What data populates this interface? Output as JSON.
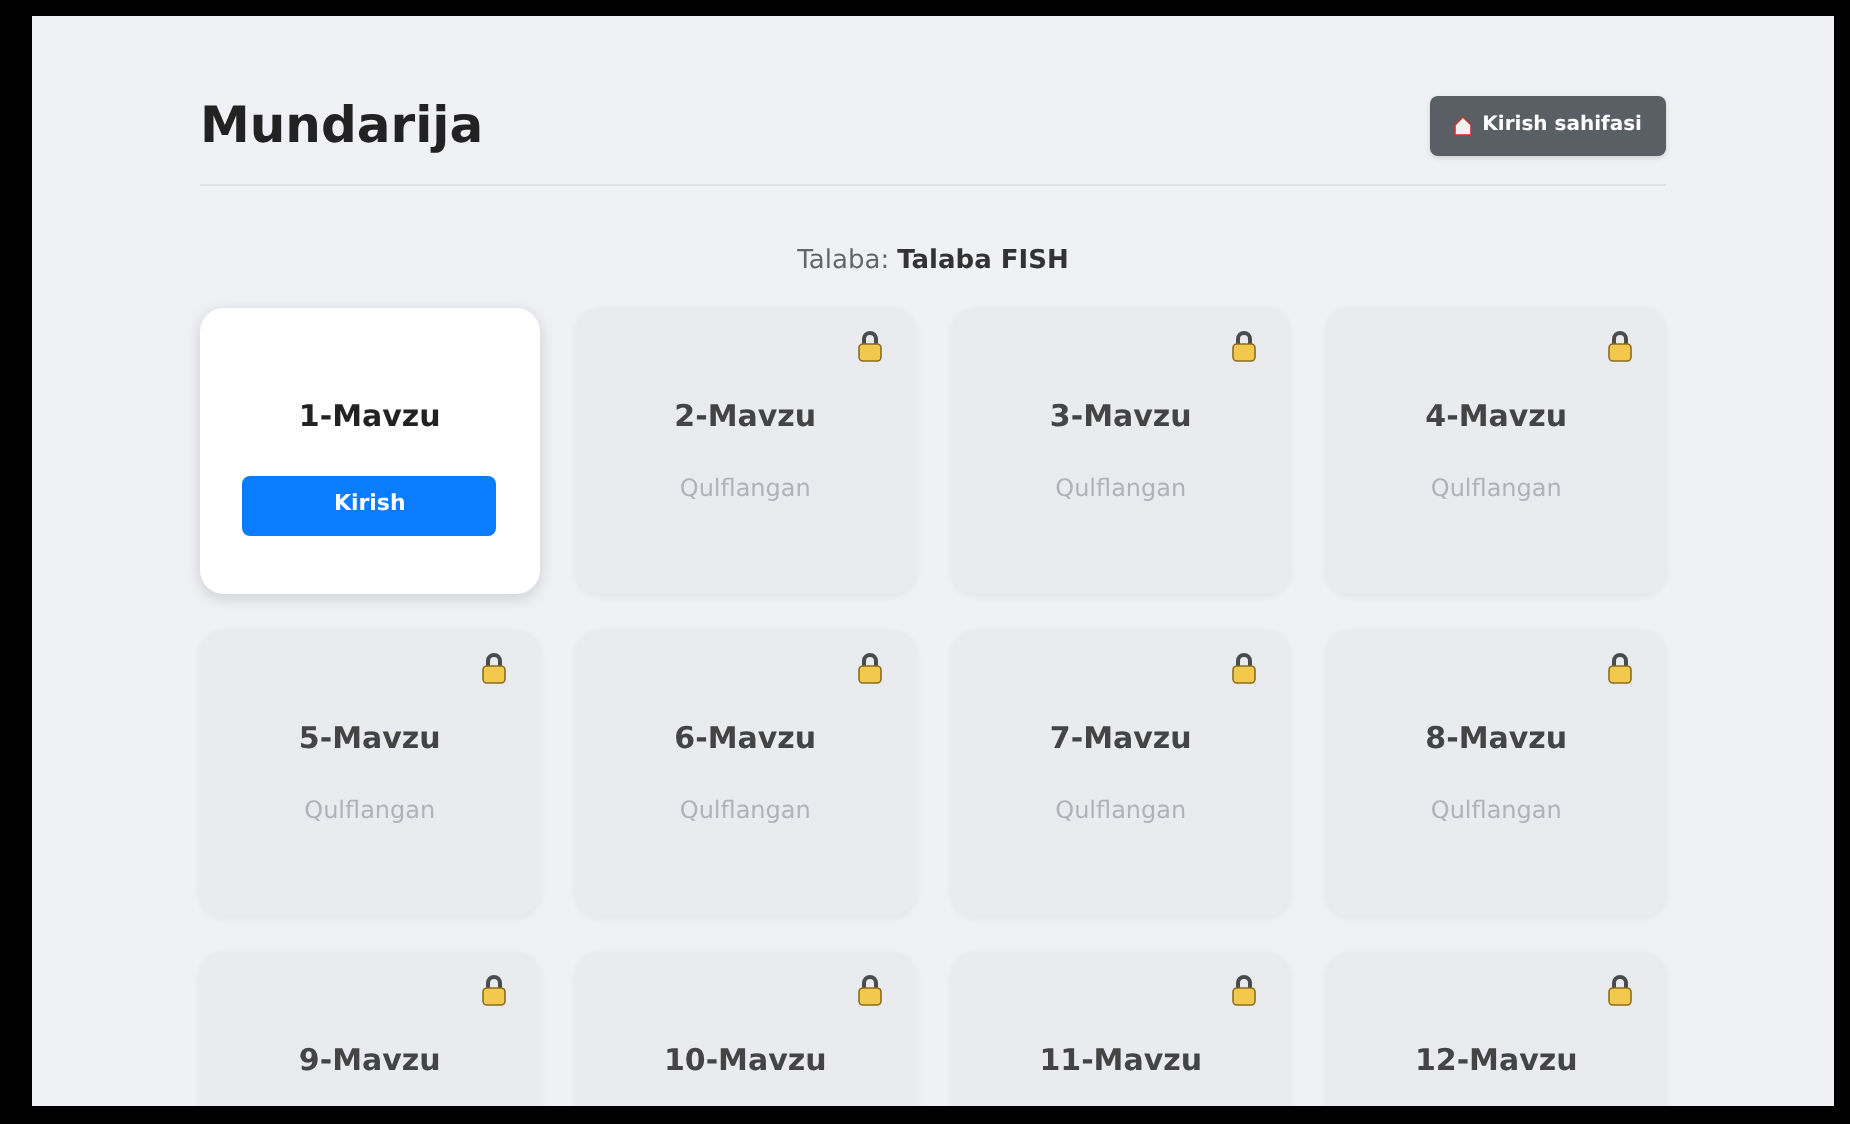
{
  "header": {
    "title": "Mundarija",
    "home_button": "Kirish sahifasi"
  },
  "student": {
    "label": "Talaba:",
    "name": "Talaba FISH"
  },
  "topics": [
    {
      "title": "1-Mavzu",
      "kind": "open",
      "action": "Kirish"
    },
    {
      "title": "2-Mavzu",
      "kind": "locked",
      "status": "Qulflangan"
    },
    {
      "title": "3-Mavzu",
      "kind": "locked",
      "status": "Qulflangan"
    },
    {
      "title": "4-Mavzu",
      "kind": "locked",
      "status": "Qulflangan"
    },
    {
      "title": "5-Mavzu",
      "kind": "locked",
      "status": "Qulflangan"
    },
    {
      "title": "6-Mavzu",
      "kind": "locked",
      "status": "Qulflangan"
    },
    {
      "title": "7-Mavzu",
      "kind": "locked",
      "status": "Qulflangan"
    },
    {
      "title": "8-Mavzu",
      "kind": "locked",
      "status": "Qulflangan"
    },
    {
      "title": "9-Mavzu",
      "kind": "locked"
    },
    {
      "title": "10-Mavzu",
      "kind": "locked"
    },
    {
      "title": "11-Mavzu",
      "kind": "locked"
    },
    {
      "title": "12-Mavzu",
      "kind": "locked"
    }
  ]
}
